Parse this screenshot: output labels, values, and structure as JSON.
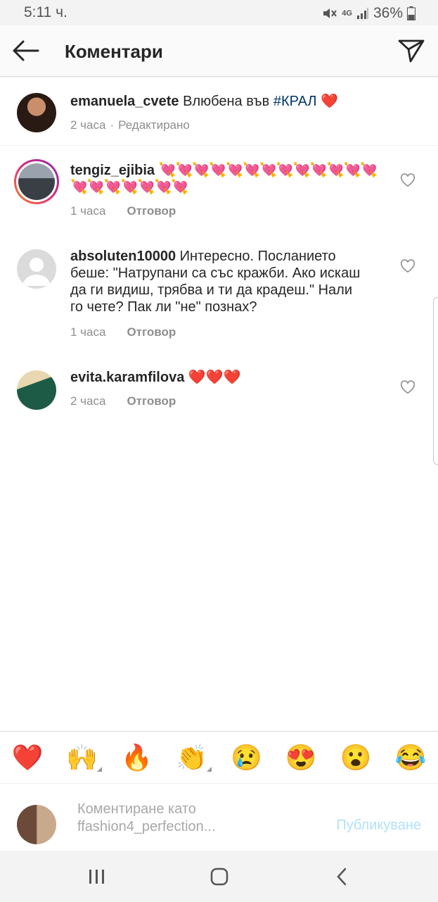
{
  "status": {
    "time": "5:11 ч.",
    "network": "4G",
    "battery": "36%"
  },
  "header": {
    "title": "Коментари"
  },
  "caption": {
    "username": "emanuela_cvete",
    "text_before": "Влюбена във",
    "hashtag": "#КРАЛ",
    "heart": "❤️",
    "time": "2 часа",
    "separator": "·",
    "edited": "Редактирано"
  },
  "comments": [
    {
      "username": "tengiz_ejibia",
      "text": "💘💘💘💘💘💘💘💘💘💘💘💘💘💘💘💘💘💘💘💘",
      "time": "1 часа",
      "reply": "Отговор"
    },
    {
      "username": "absoluten10000",
      "text": "Интересно. Посланието беше: \"Натрупани са със кражби. Ако искаш да ги видиш, трябва и ти да крадеш.\" Нали го чете? Пак ли \"не\" познах?",
      "time": "1 часа",
      "reply": "Отговор"
    },
    {
      "username": "evita.karamfilova",
      "text": "❤️❤️❤️",
      "time": "2 часа",
      "reply": "Отговор"
    }
  ],
  "reactions": [
    "❤️",
    "🙌",
    "🔥",
    "👏",
    "😢",
    "😍",
    "😮",
    "😂"
  ],
  "composer": {
    "placeholder_line1": "Коментиране като",
    "placeholder_line2": "ffashion4_perfection...",
    "publish": "Публикуване"
  },
  "colors": {
    "accent_link": "#003569",
    "publish_disabled": "#b2dffc",
    "muted": "#8e8e8e",
    "story_ring_start": "#f58529",
    "story_ring_end": "#dd2a7b"
  },
  "icons": {
    "back": "arrow-left-icon",
    "send": "paper-plane-icon",
    "like": "heart-outline-icon",
    "nav_recents": "recents-icon",
    "nav_home": "home-icon",
    "nav_back": "chevron-left-icon"
  }
}
